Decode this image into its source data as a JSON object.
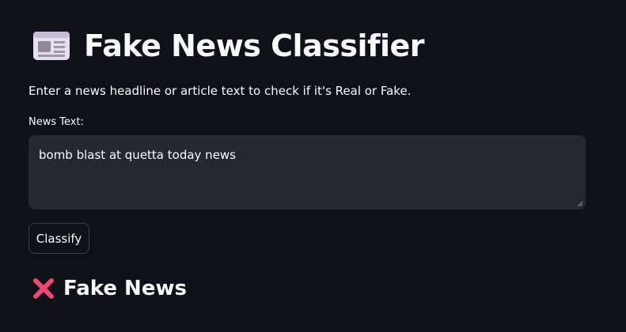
{
  "header": {
    "icon": "newspaper-icon",
    "title": "Fake News Classifier"
  },
  "intro": {
    "text": "Enter a news headline or article text to check if it's Real or Fake."
  },
  "form": {
    "label": "News Text:",
    "value": "bomb blast at quetta today news",
    "submit_label": "Classify"
  },
  "result": {
    "icon": "cross-mark-icon",
    "text": "Fake News",
    "icon_color": "#f0476e"
  },
  "colors": {
    "background": "#0e1117",
    "input_background": "#262730",
    "text": "#fafafa",
    "button_border": "#3f414a"
  }
}
